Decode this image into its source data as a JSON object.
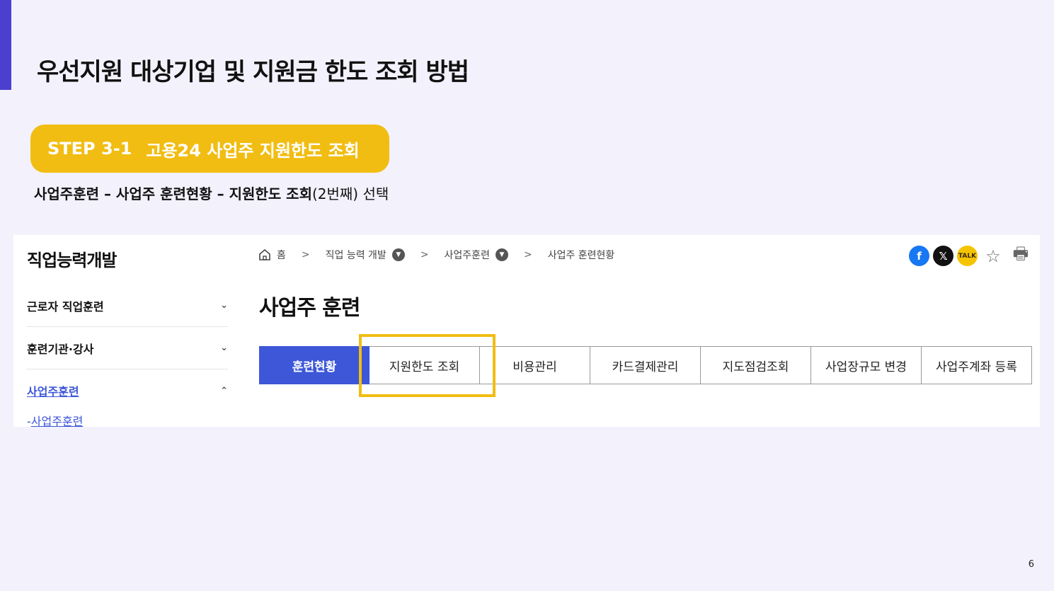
{
  "slide": {
    "title": "우선지원 대상기업 및 지원금 한도 조회 방법",
    "step_label": "STEP 3-1",
    "step_text": "고용24 사업주 지원한도 조회",
    "instruction_bold": "사업주훈련 – 사업주 훈련현황 – 지원한도 조회",
    "instruction_rest": "(2번째) 선택",
    "page_number": "6",
    "colors": {
      "accent": "#4b3fd0",
      "step_pill": "#f1bd12",
      "primary_tab": "#3d57d8"
    }
  },
  "sidebar": {
    "title": "직업능력개발",
    "items": [
      {
        "label": "근로자 직업훈련",
        "icon": "chevron-down-icon",
        "chevron": "⌄"
      },
      {
        "label": "훈련기관·강사",
        "icon": "chevron-down-icon",
        "chevron": "⌄"
      },
      {
        "label": "사업주훈련",
        "icon": "chevron-up-icon",
        "chevron": "⌃"
      }
    ],
    "sub_prefix": "-",
    "sub_label": "사업주훈련"
  },
  "breadcrumb": {
    "home": "홈",
    "items": [
      "직업 능력 개발",
      "사업주훈련",
      "사업주 훈련현황"
    ],
    "separator": ">",
    "dropdown_glyph": "▼"
  },
  "share": {
    "facebook": "f",
    "x": "𝕏",
    "kakao": "TALK",
    "star": "☆",
    "print": "🖶"
  },
  "main": {
    "heading": "사업주 훈련",
    "tabs": [
      "훈련현황",
      "지원한도 조회",
      "비용관리",
      "카드결제관리",
      "지도점검조회",
      "사업장규모 변경",
      "사업주계좌 등록"
    ]
  }
}
